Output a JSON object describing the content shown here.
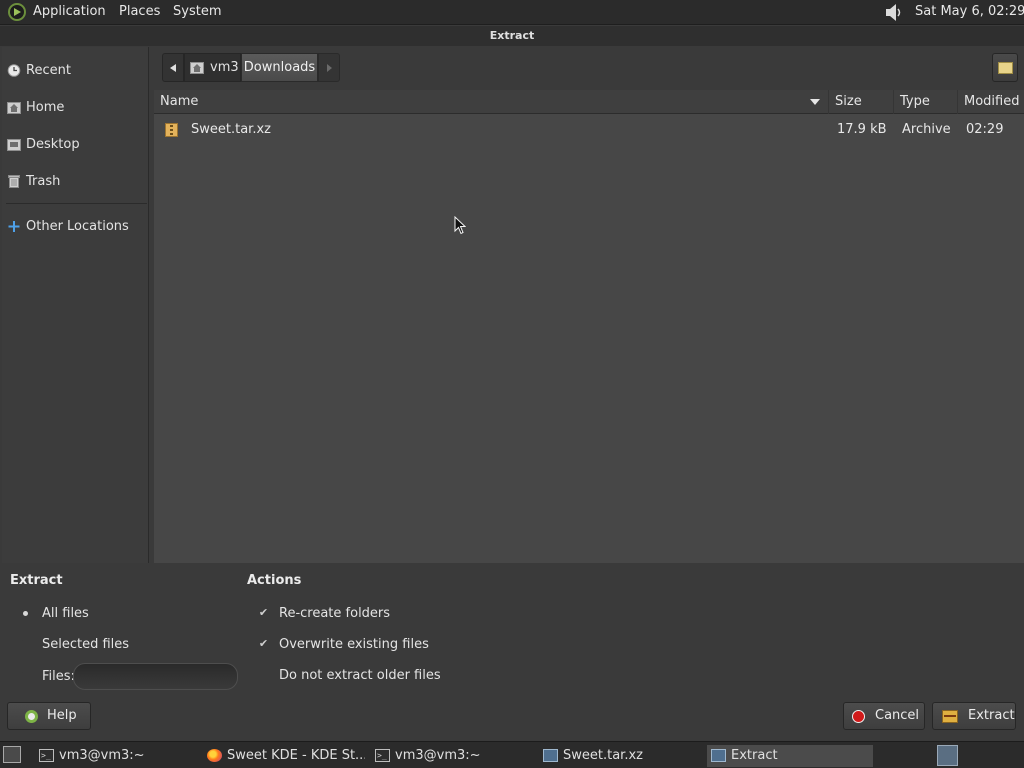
{
  "top_panel": {
    "menus": [
      "Applications",
      "Places",
      "System"
    ],
    "clock": "Sat May  6, 02:29"
  },
  "window": {
    "title": "Extract"
  },
  "sidebar": {
    "items": [
      {
        "label": "Recent",
        "icon": "clock-icon"
      },
      {
        "label": "Home",
        "icon": "home-folder-icon"
      },
      {
        "label": "Desktop",
        "icon": "desktop-folder-icon"
      },
      {
        "label": "Trash",
        "icon": "trash-icon"
      },
      {
        "label": "Other Locations",
        "icon": "plus-icon"
      }
    ]
  },
  "pathbar": {
    "segments": [
      "vm3",
      "Downloads"
    ]
  },
  "file_list": {
    "columns": [
      "Name",
      "Size",
      "Type",
      "Modified"
    ],
    "rows": [
      {
        "name": "Sweet.tar.xz",
        "size": "17.9 kB",
        "type": "Archive",
        "modified": "02:29"
      }
    ]
  },
  "extract_options": {
    "heading": "Extract",
    "all_files": "All files",
    "selected_files": "Selected files",
    "files_label": "Files:",
    "files_value": "",
    "selected": "All files"
  },
  "actions": {
    "heading": "Actions",
    "recreate_folders": "Re-create folders",
    "overwrite_existing": "Overwrite existing files",
    "do_not_extract_older": "Do not extract older files",
    "checked": [
      "Re-create folders",
      "Overwrite existing files"
    ]
  },
  "buttons": {
    "help": "Help",
    "cancel": "Cancel",
    "extract": "Extract"
  },
  "taskbar": {
    "tasks": [
      {
        "label": "vm3@vm3:~",
        "icon": "terminal-icon"
      },
      {
        "label": "Sweet KDE - KDE St...",
        "icon": "firefox-icon"
      },
      {
        "label": "vm3@vm3:~",
        "icon": "terminal-icon"
      },
      {
        "label": "Sweet.tar.xz",
        "icon": "archive-manager-icon"
      },
      {
        "label": "Extract",
        "icon": "archive-manager-icon"
      }
    ],
    "active_task": "Extract"
  },
  "colors": {
    "panel_bg": "#2b2b2b",
    "dialog_bg": "#3a3a3a",
    "list_bg": "#474747",
    "cancel_red": "#d11a1a",
    "logo_green": "#6c8f3c"
  }
}
